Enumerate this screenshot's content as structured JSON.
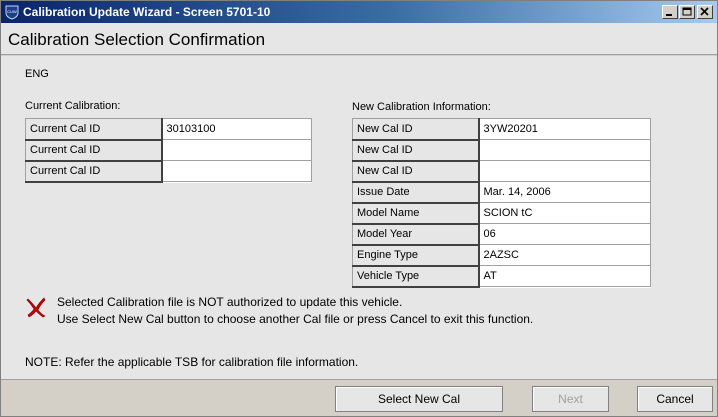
{
  "window": {
    "title": "Calibration Update Wizard - Screen 5701-10",
    "icon": "cuw-shield-icon",
    "app_icon_text": "CUW"
  },
  "header": {
    "title": "Calibration Selection Confirmation"
  },
  "module": "ENG",
  "current": {
    "label": "Current Calibration:",
    "rows": [
      {
        "label": "Current Cal ID",
        "value": "30103100"
      },
      {
        "label": "Current Cal ID",
        "value": ""
      },
      {
        "label": "Current Cal ID",
        "value": ""
      }
    ]
  },
  "new_info": {
    "label": "New Calibration Information:",
    "rows": [
      {
        "label": "New Cal ID",
        "value": "3YW20201"
      },
      {
        "label": "New Cal ID",
        "value": ""
      },
      {
        "label": "New Cal ID",
        "value": ""
      },
      {
        "label": "Issue Date",
        "value": "Mar. 14, 2006"
      },
      {
        "label": "Model Name",
        "value": "SCION tC"
      },
      {
        "label": "Model Year",
        "value": "06"
      },
      {
        "label": "Engine Type",
        "value": "2AZSC"
      },
      {
        "label": "Vehicle Type",
        "value": "AT"
      }
    ]
  },
  "message": {
    "icon": "red-x-icon",
    "line1": "Selected Calibration file is NOT authorized to update this vehicle.",
    "line2": "Use Select New Cal button to choose another Cal file or press Cancel to exit this function."
  },
  "note": "NOTE:  Refer the applicable TSB for calibration file information.",
  "buttons": {
    "select_new_cal": "Select New Cal",
    "next": "Next",
    "cancel": "Cancel"
  },
  "colors": {
    "titlebar_start": "#0a246a",
    "titlebar_end": "#a6caf0",
    "error_icon": "#cc0000"
  }
}
